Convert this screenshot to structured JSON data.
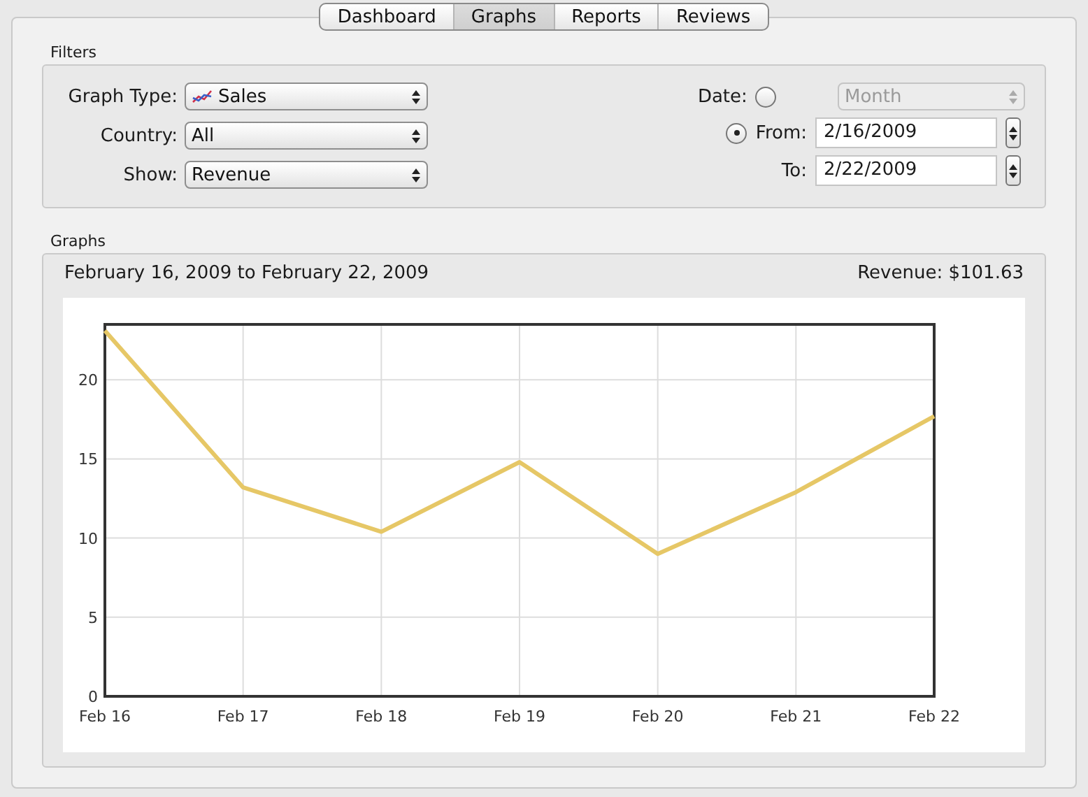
{
  "tabs": [
    {
      "label": "Dashboard",
      "selected": false
    },
    {
      "label": "Graphs",
      "selected": true
    },
    {
      "label": "Reports",
      "selected": false
    },
    {
      "label": "Reviews",
      "selected": false
    }
  ],
  "filters": {
    "title": "Filters",
    "selects": [
      {
        "label": "Graph Type:",
        "value": "Sales",
        "icon": true
      },
      {
        "label": "Country:",
        "value": "All",
        "icon": false
      },
      {
        "label": "Show:",
        "value": "Revenue",
        "icon": false
      }
    ],
    "date": {
      "label": "Date:",
      "selected": false,
      "value": "Month",
      "disabled": true
    },
    "range": {
      "selected": true,
      "from_label": "From:",
      "from": "2/16/2009",
      "to_label": "To:",
      "to": "2/22/2009"
    }
  },
  "graphs": {
    "title": "Graphs",
    "period": "February 16, 2009 to February 22, 2009",
    "total": "Revenue: $101.63",
    "chart_data": {
      "type": "line",
      "categories": [
        "Feb 16",
        "Feb 17",
        "Feb 18",
        "Feb 19",
        "Feb 20",
        "Feb 21",
        "Feb 22"
      ],
      "series": [
        {
          "color": "#e6c766",
          "values": [
            23.1,
            13.2,
            10.4,
            14.8,
            9.0,
            12.9,
            17.7
          ]
        }
      ],
      "grid": true,
      "ylim": [
        0,
        23.5
      ],
      "yticks": [
        0,
        5,
        10,
        15,
        20
      ]
    }
  }
}
